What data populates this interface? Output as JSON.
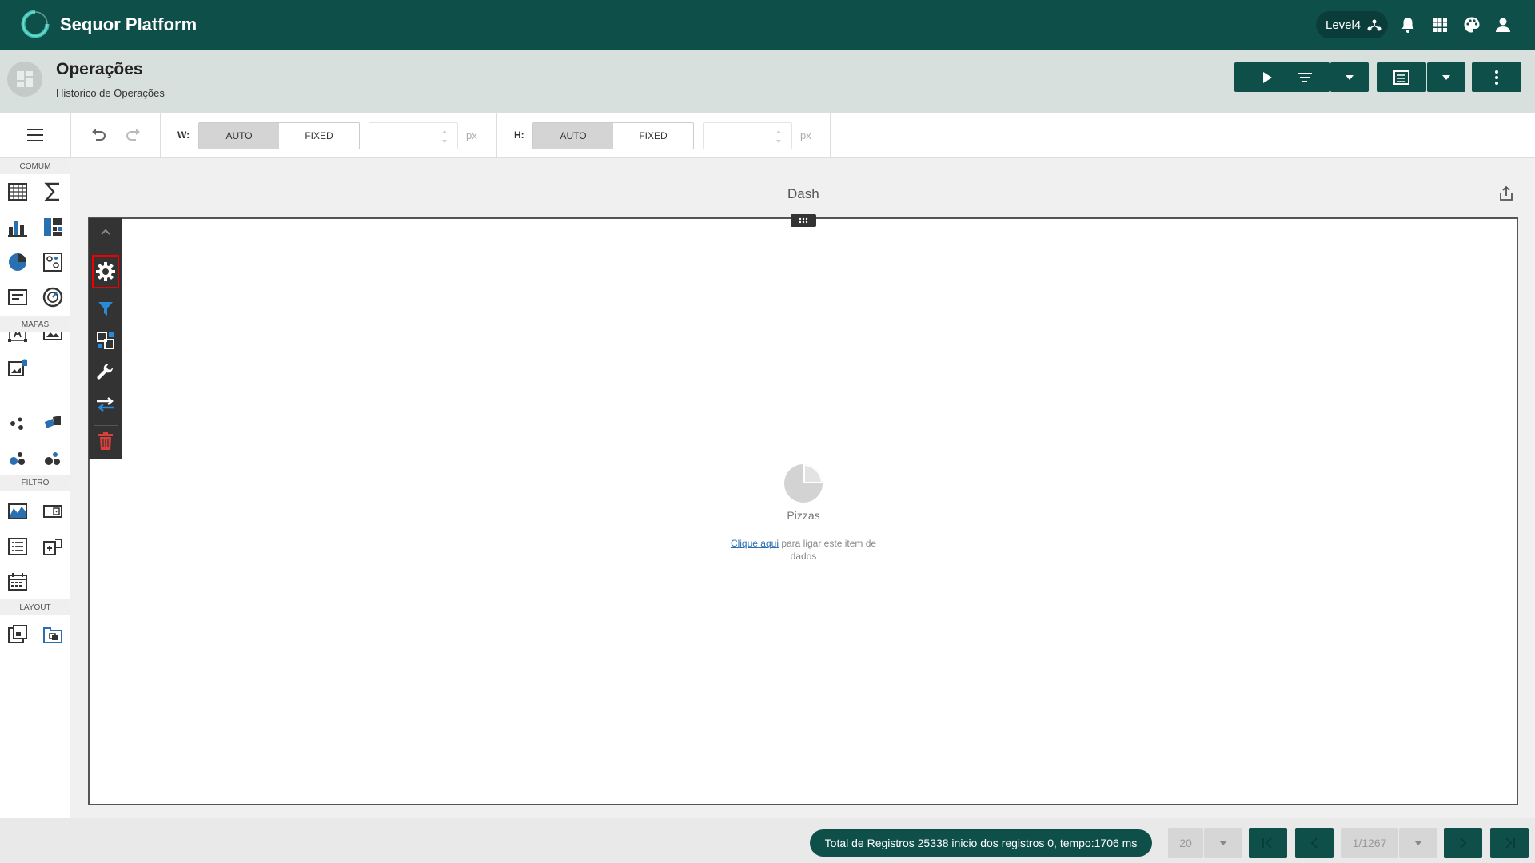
{
  "app": {
    "title": "Sequor Platform",
    "level_label": "Level4"
  },
  "page": {
    "title": "Operações",
    "subtitle": "Historico de Operações"
  },
  "toolbar": {
    "w_label": "W:",
    "h_label": "H:",
    "auto_label": "AUTO",
    "fixed_label": "FIXED",
    "unit": "px",
    "w_mode": "AUTO",
    "h_mode": "AUTO"
  },
  "sidebar": {
    "sections": [
      "COMUM",
      "MAPAS",
      "FILTRO",
      "LAYOUT"
    ]
  },
  "canvas": {
    "dash_title": "Dash",
    "item_name": "Pizzas",
    "link_text": "Clique aqui",
    "link_rest": " para ligar este item de dados"
  },
  "footer": {
    "status": "Total de Registros 25338 inicio dos registros 0, tempo:1706 ms",
    "page_size": "20",
    "page_indicator": "1/1267"
  },
  "colors": {
    "brand": "#0f4f4a",
    "accent_blue": "#2a6fb0",
    "delete_red": "#d9403a"
  }
}
